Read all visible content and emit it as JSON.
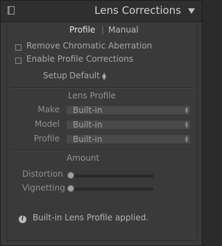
{
  "header": {
    "title": "Lens Corrections"
  },
  "tabs": [
    {
      "label": "Profile",
      "active": true
    },
    {
      "label": "Manual",
      "active": false
    }
  ],
  "tab_separator": "|",
  "checkboxes": [
    {
      "label": "Remove Chromatic Aberration",
      "checked": false
    },
    {
      "label": "Enable Profile Corrections",
      "checked": false
    }
  ],
  "setup": {
    "label": "Setup",
    "value": "Default"
  },
  "lens_profile": {
    "title": "Lens Profile",
    "fields": [
      {
        "label": "Make",
        "value": "Built-in"
      },
      {
        "label": "Model",
        "value": "Built-in"
      },
      {
        "label": "Profile",
        "value": "Built-in"
      }
    ]
  },
  "amount": {
    "title": "Amount",
    "sliders": [
      {
        "label": "Distortion",
        "level": 0.0
      },
      {
        "label": "Vignetting",
        "level": 0.0
      }
    ]
  },
  "info": {
    "icon": "info-icon",
    "message": "Built-in Lens Profile applied."
  },
  "colors": {
    "panel_bg": "#3a3a3a",
    "header_bg": "#2f2f2f",
    "text_active": "#e8e8e8",
    "text_dim": "#8f8f8f"
  }
}
